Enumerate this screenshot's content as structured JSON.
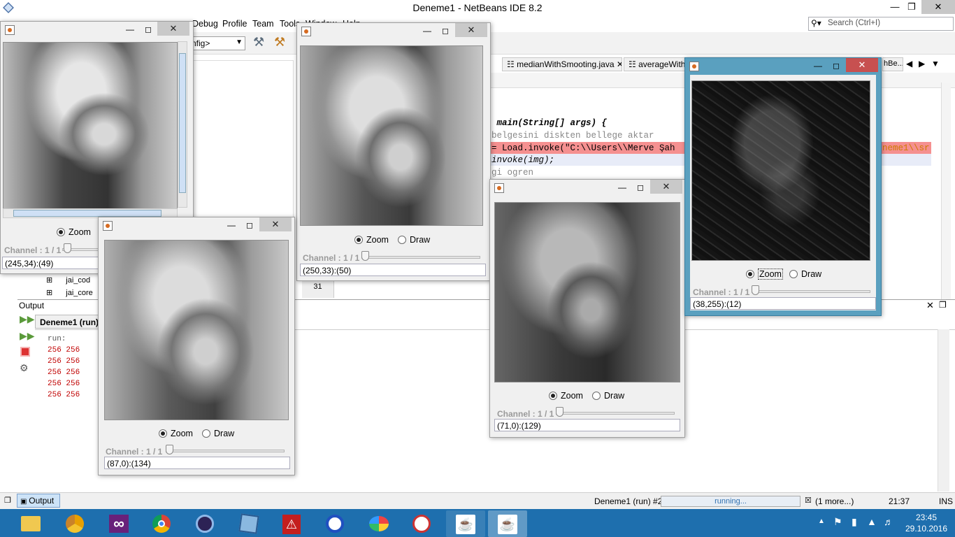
{
  "ide": {
    "title": "Deneme1 - NetBeans IDE 8.2",
    "menu": [
      "Debug",
      "Profile",
      "Team",
      "Tools",
      "Window",
      "Help"
    ],
    "search_placeholder": "Search (Ctrl+I)",
    "config_combo": "nfig>",
    "tabs": [
      "medianWithSmooting.java",
      "averageWithS",
      "hBe..."
    ],
    "code_lines": [
      {
        "text": " main(String[] args) {"
      },
      {
        "text": "belgesini diskten bellege aktar"
      },
      {
        "text": "= Load.invoke(\"C:\\\\Users\\\\Merve Şah"
      },
      {
        "text": "invoke(img);"
      },
      {
        "text": "gi ogren"
      }
    ],
    "code_line_error_tail": "neme1\\\\sr",
    "line_number": "31",
    "tree_items": [
      "jai_cod",
      "jai_core"
    ],
    "output": {
      "title": "Output",
      "run_tab": "Deneme1 (run)",
      "lines": [
        "run:",
        "256 256",
        "256 256",
        "256 256",
        "256 256",
        "256 256"
      ]
    },
    "status": {
      "output_btn": "Output",
      "process": "Deneme1 (run) #2",
      "progress_text": "running...",
      "more": "(1 more...)",
      "position": "21:37",
      "mode": "INS"
    },
    "clock": {
      "time": "23:45",
      "date": "29.10.2016"
    }
  },
  "viewers": [
    {
      "id": "w1",
      "zoom": "Zoom",
      "channel": "Channel : 1 / 1",
      "coord": "(245,34):(49)"
    },
    {
      "id": "w2",
      "zoom": "Zoom",
      "draw": "Draw",
      "channel": "Channel : 1 / 1",
      "coord": "(87,0):(134)"
    },
    {
      "id": "w3",
      "zoom": "Zoom",
      "draw": "Draw",
      "channel": "Channel : 1 / 1",
      "coord": "(250,33):(50)"
    },
    {
      "id": "w4",
      "zoom": "Zoom",
      "draw": "Draw",
      "channel": "Channel : 1 / 1",
      "coord": "(71,0):(129)"
    },
    {
      "id": "w5",
      "zoom": "Zoom",
      "draw": "Draw",
      "channel": "Channel : 1 / 1",
      "coord": "(38,255):(12)"
    }
  ],
  "colors": {
    "taskbar": "#1e6fae",
    "active_window": "#5aa0bf",
    "close_active": "#c75050"
  },
  "taskbar_icons": [
    "file-explorer-icon",
    "chrome-canary-icon",
    "visual-studio-icon",
    "chrome-icon",
    "eclipse-icon",
    "virtualbox-icon",
    "acrobat-icon",
    "ncss-icon",
    "paint-icon",
    "snipping-tool-icon",
    "java-icon",
    "java-icon"
  ]
}
